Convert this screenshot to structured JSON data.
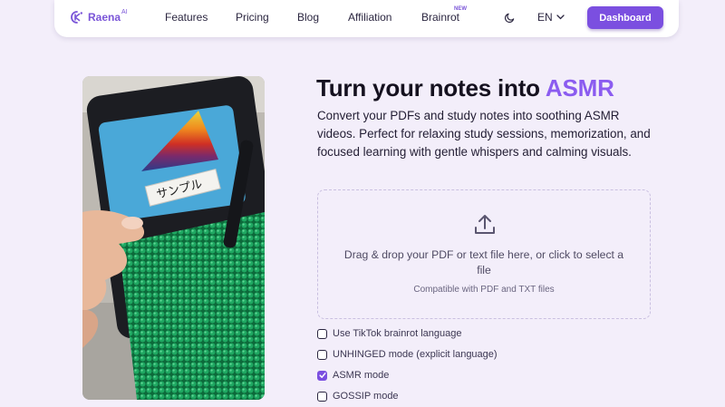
{
  "nav": {
    "brand": "Raena",
    "brand_sup": "AI",
    "links": [
      "Features",
      "Pricing",
      "Blog",
      "Affiliation",
      "Brainrot"
    ],
    "new_badge": "NEW",
    "language": "EN",
    "dashboard_label": "Dashboard"
  },
  "hero": {
    "title_main": "Turn your notes into ",
    "title_accent": "ASMR",
    "description": "Convert your PDFs and study notes into soothing ASMR videos. Perfect for relaxing study sessions, memorization, and focused learning with gentle whispers and calming visuals."
  },
  "photo": {
    "label_text": "サンプル"
  },
  "dropzone": {
    "main_text": "Drag & drop your PDF or text file here, or click to select a file",
    "sub_text": "Compatible with PDF and TXT files"
  },
  "options": [
    {
      "label": "Use TikTok brainrot language",
      "checked": false
    },
    {
      "label": "UNHINGED mode (explicit language)",
      "checked": false
    },
    {
      "label": "ASMR mode",
      "checked": true
    },
    {
      "label": "GOSSIP mode",
      "checked": false
    }
  ],
  "colors": {
    "accent": "#8b5cf0",
    "button": "#7b4fe0",
    "background": "#f3eefa"
  }
}
